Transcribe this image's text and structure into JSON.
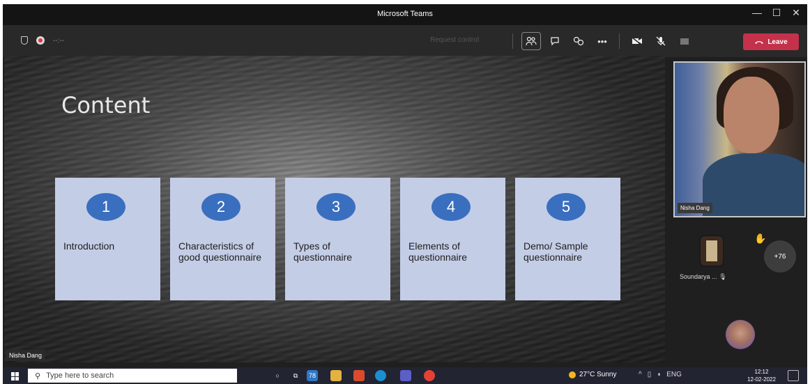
{
  "window": {
    "title": "Microsoft Teams",
    "minimize": "—",
    "maximize": "☐",
    "close": "✕"
  },
  "toolbar": {
    "timer": "--:--",
    "request_control": "Request control",
    "leave_label": "Leave"
  },
  "slide": {
    "title": "Content",
    "items": [
      {
        "number": "1",
        "label": "Introduction"
      },
      {
        "number": "2",
        "label": "Characteristics of good questionnaire"
      },
      {
        "number": "3",
        "label": "Types of questionnaire"
      },
      {
        "number": "4",
        "label": "Elements of questionnaire"
      },
      {
        "number": "5",
        "label": "Demo/ Sample questionnaire"
      }
    ],
    "presenter_tag": "Nisha Dang"
  },
  "participants": {
    "main_video_name": "Nisha Dang",
    "participant_name": "Soundarya ...",
    "more_count": "+76"
  },
  "taskbar": {
    "search_placeholder": "Type here to search",
    "teams_badge": "78",
    "weather": "27°C  Sunny",
    "language": "ENG",
    "time": "12:12",
    "date": "12-02-2022"
  },
  "colors": {
    "leave": "#c4314b",
    "badge": "#3a6fbf",
    "card": "#c4cde6"
  }
}
